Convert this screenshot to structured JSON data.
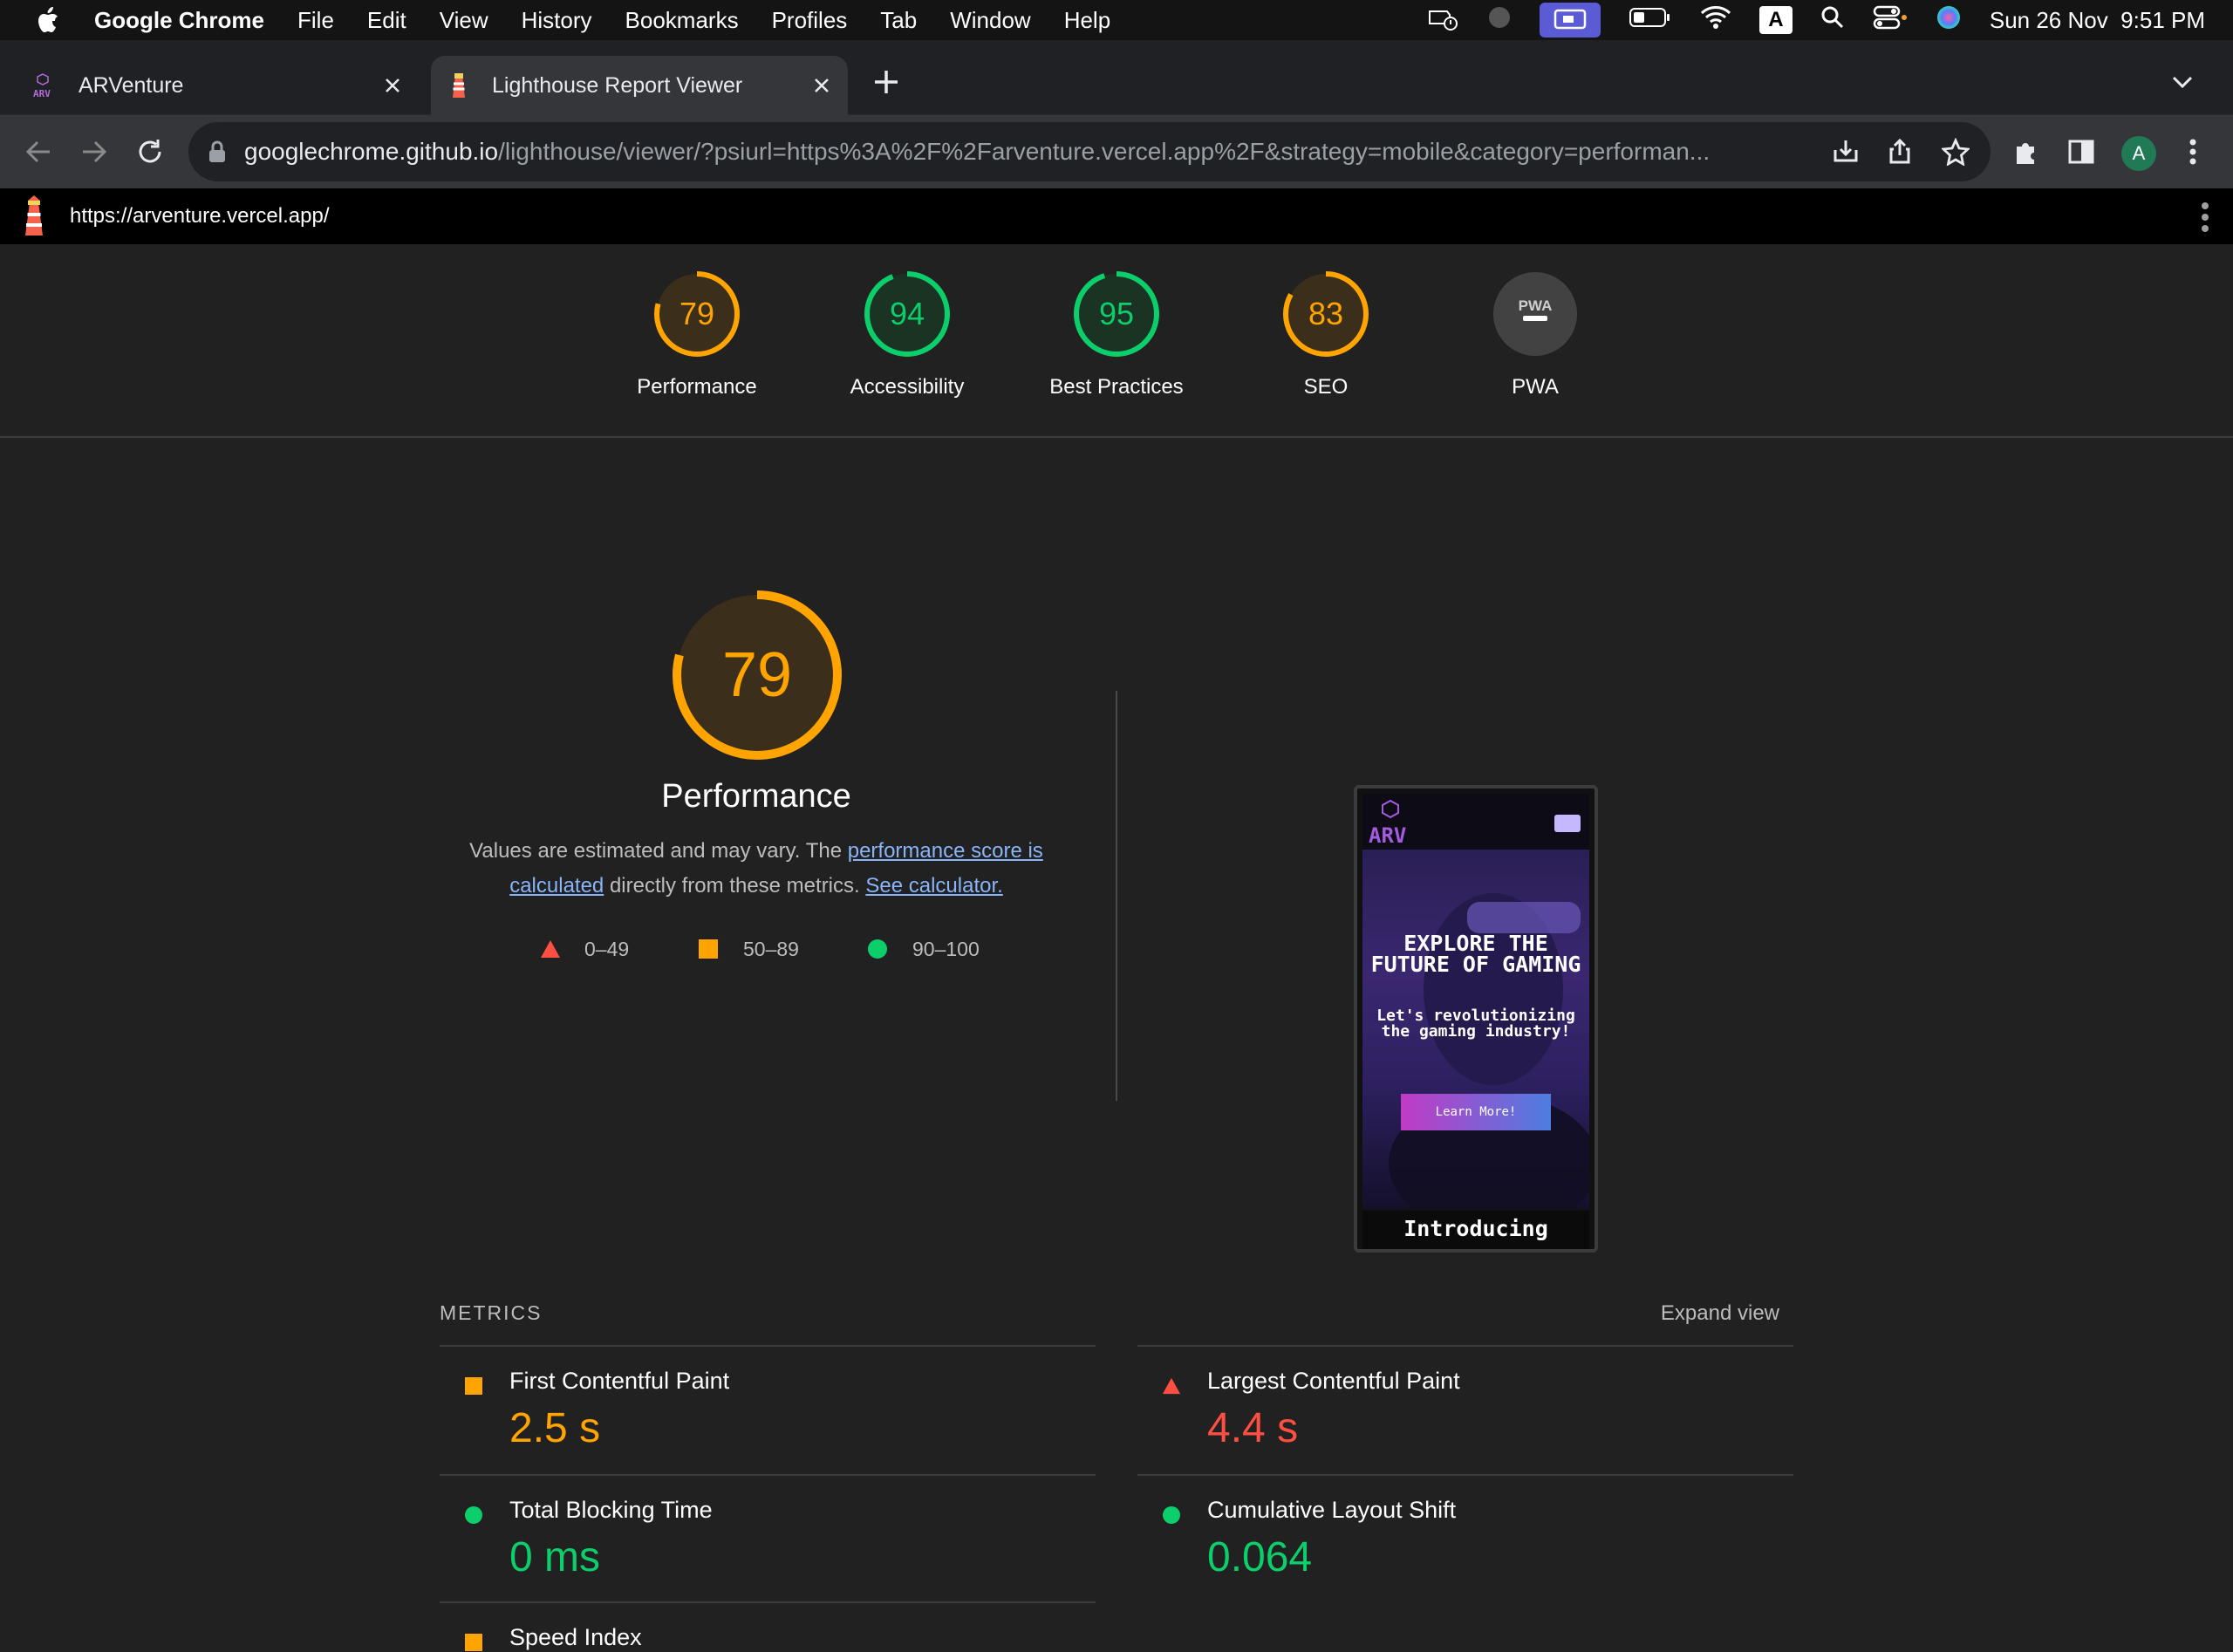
{
  "menubar": {
    "app_name": "Google Chrome",
    "items": [
      "File",
      "Edit",
      "View",
      "History",
      "Bookmarks",
      "Profiles",
      "Tab",
      "Window",
      "Help"
    ],
    "input_indicator": "A",
    "datetime": "Sun 26 Nov  9:51 PM"
  },
  "tabs": [
    {
      "title": "ARVenture",
      "favicon": "arv-logo-icon",
      "active": false
    },
    {
      "title": "Lighthouse Report Viewer",
      "favicon": "lighthouse-icon",
      "active": true
    }
  ],
  "omnibox": {
    "host": "googlechrome.github.io",
    "path": "/lighthouse/viewer/?psiurl=https%3A%2F%2Farventure.vercel.app%2F&strategy=mobile&category=performan..."
  },
  "profile_initial": "A",
  "lighthouse_bar": {
    "url": "https://arventure.vercel.app/"
  },
  "colors": {
    "orange": "#ffa400",
    "green": "#0cce6b",
    "red": "#ff4e42",
    "link": "#8ab4f8"
  },
  "gauges": [
    {
      "label": "Performance",
      "score": "79",
      "value": 79,
      "status": "average"
    },
    {
      "label": "Accessibility",
      "score": "94",
      "value": 94,
      "status": "pass"
    },
    {
      "label": "Best Practices",
      "score": "95",
      "value": 95,
      "status": "pass"
    },
    {
      "label": "SEO",
      "score": "83",
      "value": 83,
      "status": "average"
    },
    {
      "label": "PWA",
      "badge": "PWA",
      "status": "na"
    }
  ],
  "performance": {
    "score": "79",
    "value": 79,
    "title": "Performance",
    "desc_prefix": "Values are estimated and may vary. The ",
    "desc_link1": "performance score is calculated",
    "desc_middle": " directly from these metrics. ",
    "desc_link2": "See calculator."
  },
  "legend": [
    {
      "range": "0–49",
      "shape": "triangle",
      "color": "#ff4e42"
    },
    {
      "range": "50–89",
      "shape": "square",
      "color": "#ffa400"
    },
    {
      "range": "90–100",
      "shape": "circle",
      "color": "#0cce6b"
    }
  ],
  "screenshot": {
    "logo_text": "ARV",
    "headline": "EXPLORE THE FUTURE OF GAMING",
    "subhead": "Let's revolutionizing the gaming industry!",
    "button": "Learn More!",
    "section": "Introducing"
  },
  "metrics": {
    "heading": "METRICS",
    "expand": "Expand view",
    "items": [
      {
        "name": "First Contentful Paint",
        "value": "2.5 s",
        "status": "average"
      },
      {
        "name": "Largest Contentful Paint",
        "value": "4.4 s",
        "status": "fail"
      },
      {
        "name": "Total Blocking Time",
        "value": "0 ms",
        "status": "pass"
      },
      {
        "name": "Cumulative Layout Shift",
        "value": "0.064",
        "status": "pass"
      },
      {
        "name": "Speed Index",
        "value": "",
        "status": "average"
      }
    ]
  }
}
